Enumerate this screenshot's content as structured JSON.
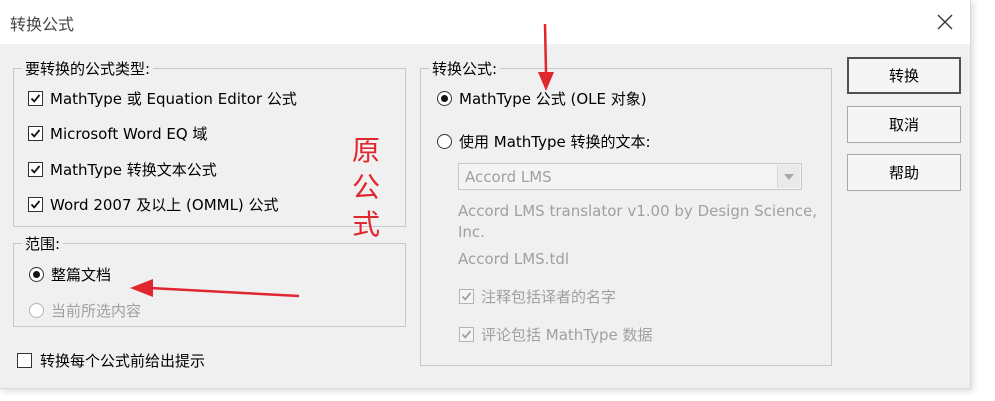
{
  "window": {
    "title": "转换公式"
  },
  "types_group": {
    "legend": "要转换的公式类型:",
    "items": [
      {
        "label": "MathType 或 Equation Editor 公式",
        "checked": true
      },
      {
        "label": "Microsoft Word EQ 域",
        "checked": true
      },
      {
        "label": "MathType 转换文本公式",
        "checked": true
      },
      {
        "label": "Word 2007 及以上 (OMML) 公式",
        "checked": true
      }
    ]
  },
  "range_group": {
    "legend": "范围:",
    "options": [
      {
        "label": "整篇文档",
        "selected": true
      },
      {
        "label": "当前所选内容",
        "selected": false,
        "disabled": true
      }
    ]
  },
  "prompt_checkbox": {
    "label": "转换每个公式前给出提示",
    "checked": false
  },
  "convert_group": {
    "legend": "转换公式:",
    "option_ole": {
      "label": "MathType 公式 (OLE 对象)",
      "selected": true
    },
    "option_text": {
      "label": "使用 MathType 转换的文本:",
      "selected": false
    },
    "translator_select": {
      "value": "Accord LMS"
    },
    "translator_desc_line1": "Accord LMS translator v1.00 by Design Science,",
    "translator_desc_line2": "Inc.",
    "translator_file": "Accord LMS.tdl",
    "include_translator_name": {
      "label": "注释包括译者的名字",
      "checked": true
    },
    "include_mathtype_data": {
      "label": "评论包括 MathType 数据",
      "checked": true
    }
  },
  "buttons": {
    "convert": "转换",
    "cancel": "取消",
    "help": "帮助"
  },
  "annotation": {
    "text_1": "原",
    "text_2": "公",
    "text_3": "式"
  },
  "colors": {
    "annotation_red": "#e0262e",
    "dialog_bg": "#f0f0f0"
  },
  "icons": {
    "close": "close-icon",
    "check": "checkmark-icon",
    "dropdown": "chevron-down-icon",
    "arrow": "red-arrow-icon"
  }
}
